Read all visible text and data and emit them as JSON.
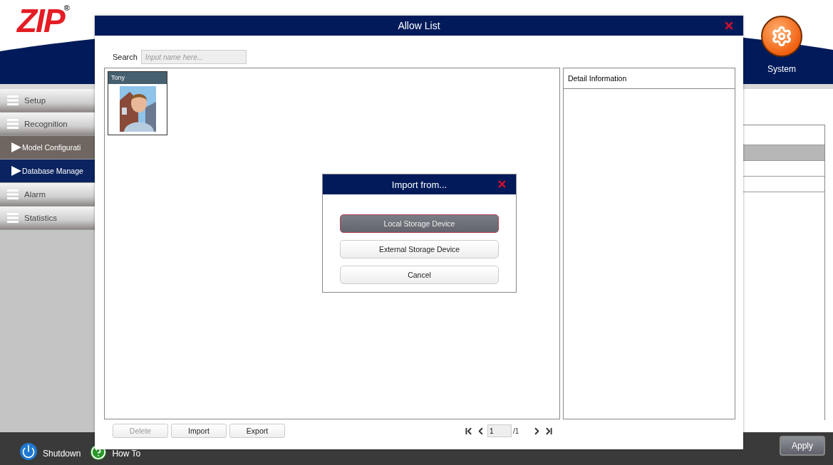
{
  "header": {
    "logo": "ZIP$^{®}$",
    "system_label": "System"
  },
  "sidebar": {
    "items": [
      {
        "label": "Setup",
        "kind": "group",
        "selected": false
      },
      {
        "label": "Recognition",
        "kind": "group",
        "selected": false
      },
      {
        "label": "Model Configurati",
        "kind": "sub",
        "selected": false
      },
      {
        "label": "Database Manage",
        "kind": "sub",
        "selected": true
      },
      {
        "label": "Alarm",
        "kind": "group",
        "selected": false
      },
      {
        "label": "Statistics",
        "kind": "group",
        "selected": false
      }
    ]
  },
  "side_table": {
    "rows": [
      {
        "selected": true
      },
      {
        "selected": false
      },
      {
        "selected": false
      },
      {
        "selected": false
      }
    ]
  },
  "bottom_bar": {
    "shutdown": "Shutdown",
    "how_to": "How To",
    "apply": "Apply"
  },
  "dialog": {
    "title": "Allow List",
    "search": {
      "label": "Search",
      "placeholder": "Input name here..."
    },
    "people": [
      {
        "name": "Tony",
        "kind": "picture"
      }
    ],
    "detail_title": "Detail Information",
    "buttons": [
      {
        "label": "Delete",
        "disabled": true
      },
      {
        "label": "Import",
        "disabled": false
      },
      {
        "label": "Export",
        "disabled": false
      }
    ],
    "pagination": {
      "page": "1",
      "total": "/1"
    }
  },
  "import_dialog": {
    "title": "Import from...",
    "options": [
      {
        "label": "Local Storage Device",
        "selected": true
      },
      {
        "label": "External Storage Device",
        "selected": false
      },
      {
        "label": "Cancel",
        "selected": false
      }
    ]
  }
}
